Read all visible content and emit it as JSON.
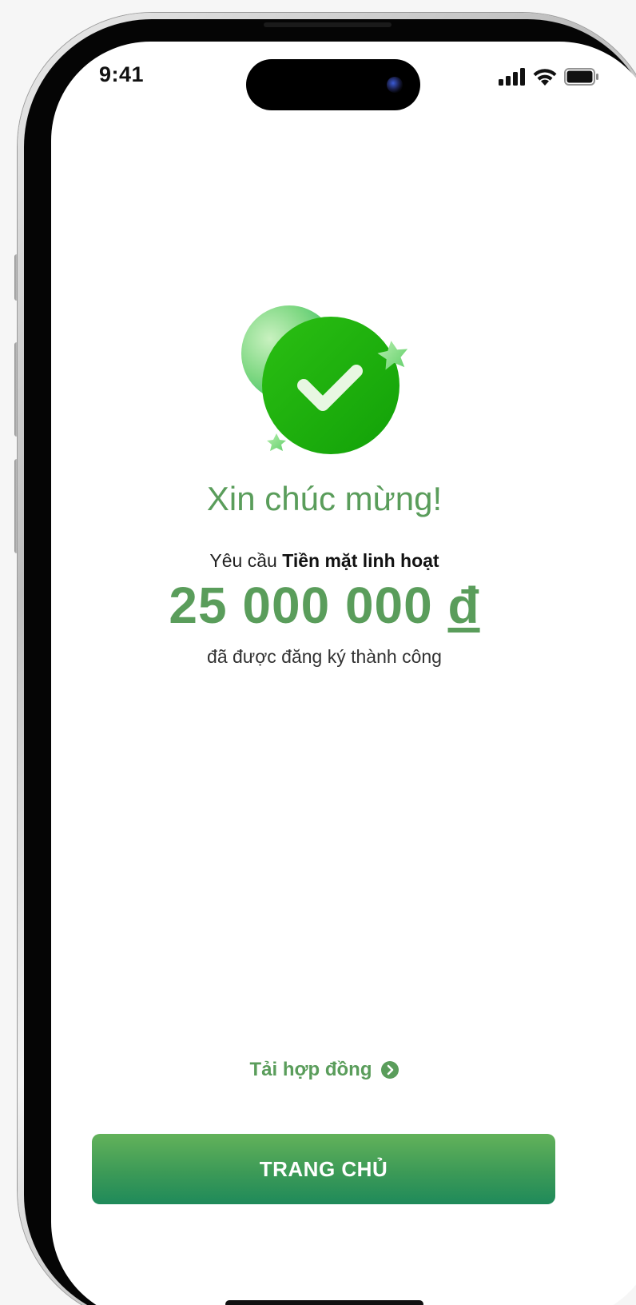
{
  "status_bar": {
    "time": "9:41",
    "icons": [
      "signal-icon",
      "wifi-icon",
      "battery-icon"
    ]
  },
  "success": {
    "icon": "check-circle-icon",
    "title": "Xin chúc mừng!",
    "subtitle_prefix": "Yêu cầu ",
    "product_name": "Tiền mặt linh hoạt",
    "amount": "25 000 000",
    "currency": "đ",
    "message": "đã được đăng ký thành công"
  },
  "actions": {
    "download_label": "Tải hợp đồng",
    "download_icon": "chevron-right-circle-icon",
    "home_button_label": "TRANG CHỦ"
  },
  "colors": {
    "primary_green": "#5a9d5b",
    "button_gradient_top": "#63b25a",
    "button_gradient_bottom": "#1f8a5a",
    "check_circle": "#17a50a"
  }
}
